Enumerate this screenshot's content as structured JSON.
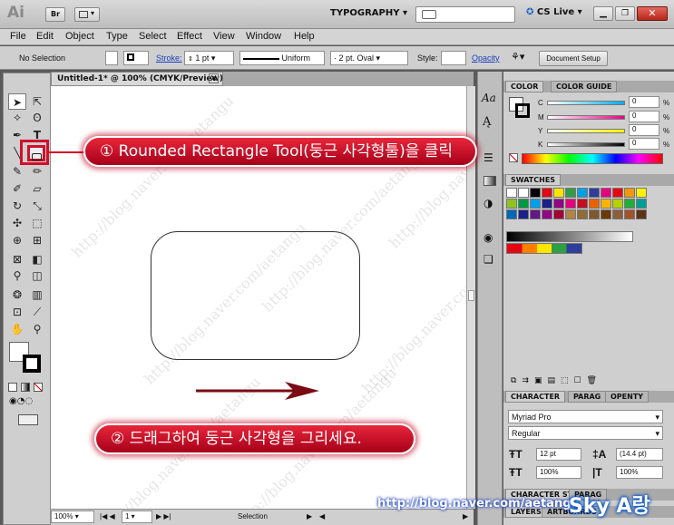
{
  "appbar": {
    "logo": "Ai",
    "bridge_label": "Br",
    "workspace": "TYPOGRAPHY",
    "cs_live": "CS Live"
  },
  "menu": [
    "File",
    "Edit",
    "Object",
    "Type",
    "Select",
    "Effect",
    "View",
    "Window",
    "Help"
  ],
  "control": {
    "selection": "No Selection",
    "stroke_label": "Stroke:",
    "stroke_value": "1 pt",
    "profile": "Uniform",
    "brush": "2 pt. Oval",
    "style_label": "Style:",
    "opacity_label": "Opacity",
    "doc_setup": "Document Setup"
  },
  "document": {
    "tab_title": "Untitled-1* @ 100% (CMYK/Preview)",
    "close_glyph": "×"
  },
  "status": {
    "zoom": "100%",
    "artboard": "1",
    "tool": "Selection"
  },
  "color_panel": {
    "tab_color": "COLOR",
    "tab_guide": "COLOR GUIDE",
    "c": "0",
    "m": "0",
    "y": "0",
    "k": "0",
    "c_lbl": "C",
    "m_lbl": "M",
    "y_lbl": "Y",
    "k_lbl": "K",
    "pct": "%"
  },
  "swatches_panel": {
    "title": "SWATCHES"
  },
  "character_panel": {
    "tab_char": "CHARACTER",
    "tab_para": "PARAG",
    "tab_opentype": "OPENTY",
    "font": "Myriad Pro",
    "style": "Regular",
    "size": "12 pt",
    "leading": "(14.4 pt)",
    "hscale": "100%",
    "vscale": "100%"
  },
  "bottom_tabs": {
    "char_styles": "CHARACTER ST",
    "para": "PARAG",
    "layers": "LAYERS",
    "artboards": "ARTBOARDS"
  },
  "annotations": {
    "step1": "① Rounded Rectangle Tool(둥근 사각형툴)을 클릭",
    "step2": "② 드래그하여 둥근 사각형을 그리세요."
  },
  "watermark": {
    "url": "http://blog.naver.com/aetangu",
    "brand": "Sky A랑"
  },
  "colors": {
    "accent_red": "#c8102e",
    "panel_gray": "#cfcfcf"
  }
}
